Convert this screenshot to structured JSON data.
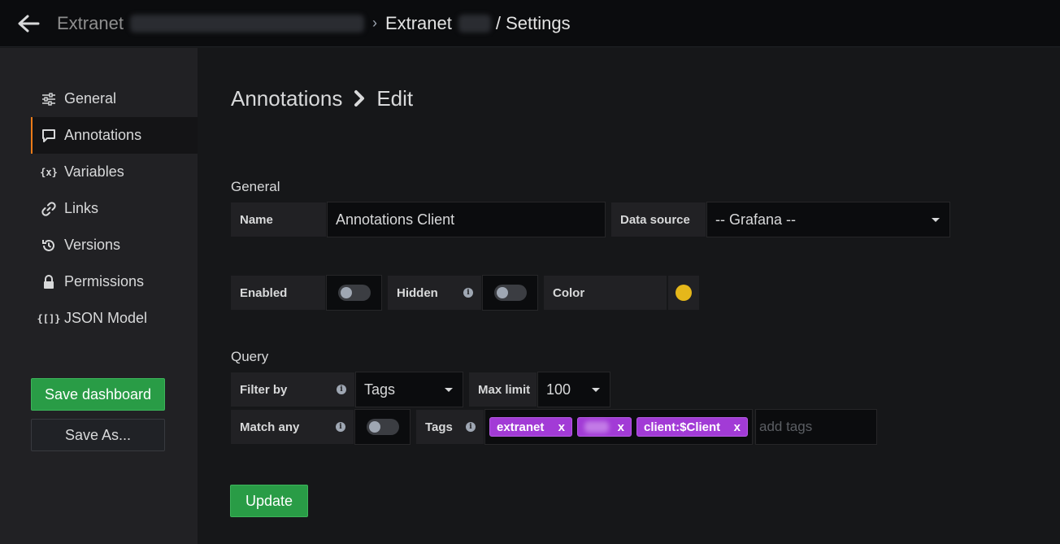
{
  "breadcrumb": {
    "root": "Extranet",
    "separator": "›",
    "current": "Extranet",
    "current_suffix": "/ Settings"
  },
  "sidebar": {
    "items": [
      {
        "label": "General",
        "icon": "sliders-icon",
        "active": false
      },
      {
        "label": "Annotations",
        "icon": "comment-icon",
        "active": true
      },
      {
        "label": "Variables",
        "icon": "variable-icon",
        "glyph": "{x}",
        "active": false
      },
      {
        "label": "Links",
        "icon": "link-icon",
        "active": false
      },
      {
        "label": "Versions",
        "icon": "history-icon",
        "active": false
      },
      {
        "label": "Permissions",
        "icon": "lock-icon",
        "active": false
      },
      {
        "label": "JSON Model",
        "icon": "json-icon",
        "glyph": "{[]}",
        "active": false
      }
    ],
    "save_label": "Save dashboard",
    "save_as_label": "Save As..."
  },
  "page": {
    "title": "Annotations",
    "subtitle": "Edit"
  },
  "general": {
    "heading": "General",
    "name_label": "Name",
    "name_value": "Annotations Client",
    "datasource_label": "Data source",
    "datasource_value": "-- Grafana --",
    "enabled_label": "Enabled",
    "enabled": false,
    "hidden_label": "Hidden",
    "hidden": false,
    "color_label": "Color",
    "color": "#e5b71a"
  },
  "query": {
    "heading": "Query",
    "filter_label": "Filter by",
    "filter_value": "Tags",
    "maxlimit_label": "Max limit",
    "maxlimit_value": "100",
    "matchany_label": "Match any",
    "matchany": false,
    "tags_label": "Tags",
    "tags": [
      "extranet",
      "",
      "client:$Client"
    ],
    "tag_remove": "x",
    "add_tags_placeholder": "add tags"
  },
  "update_label": "Update"
}
